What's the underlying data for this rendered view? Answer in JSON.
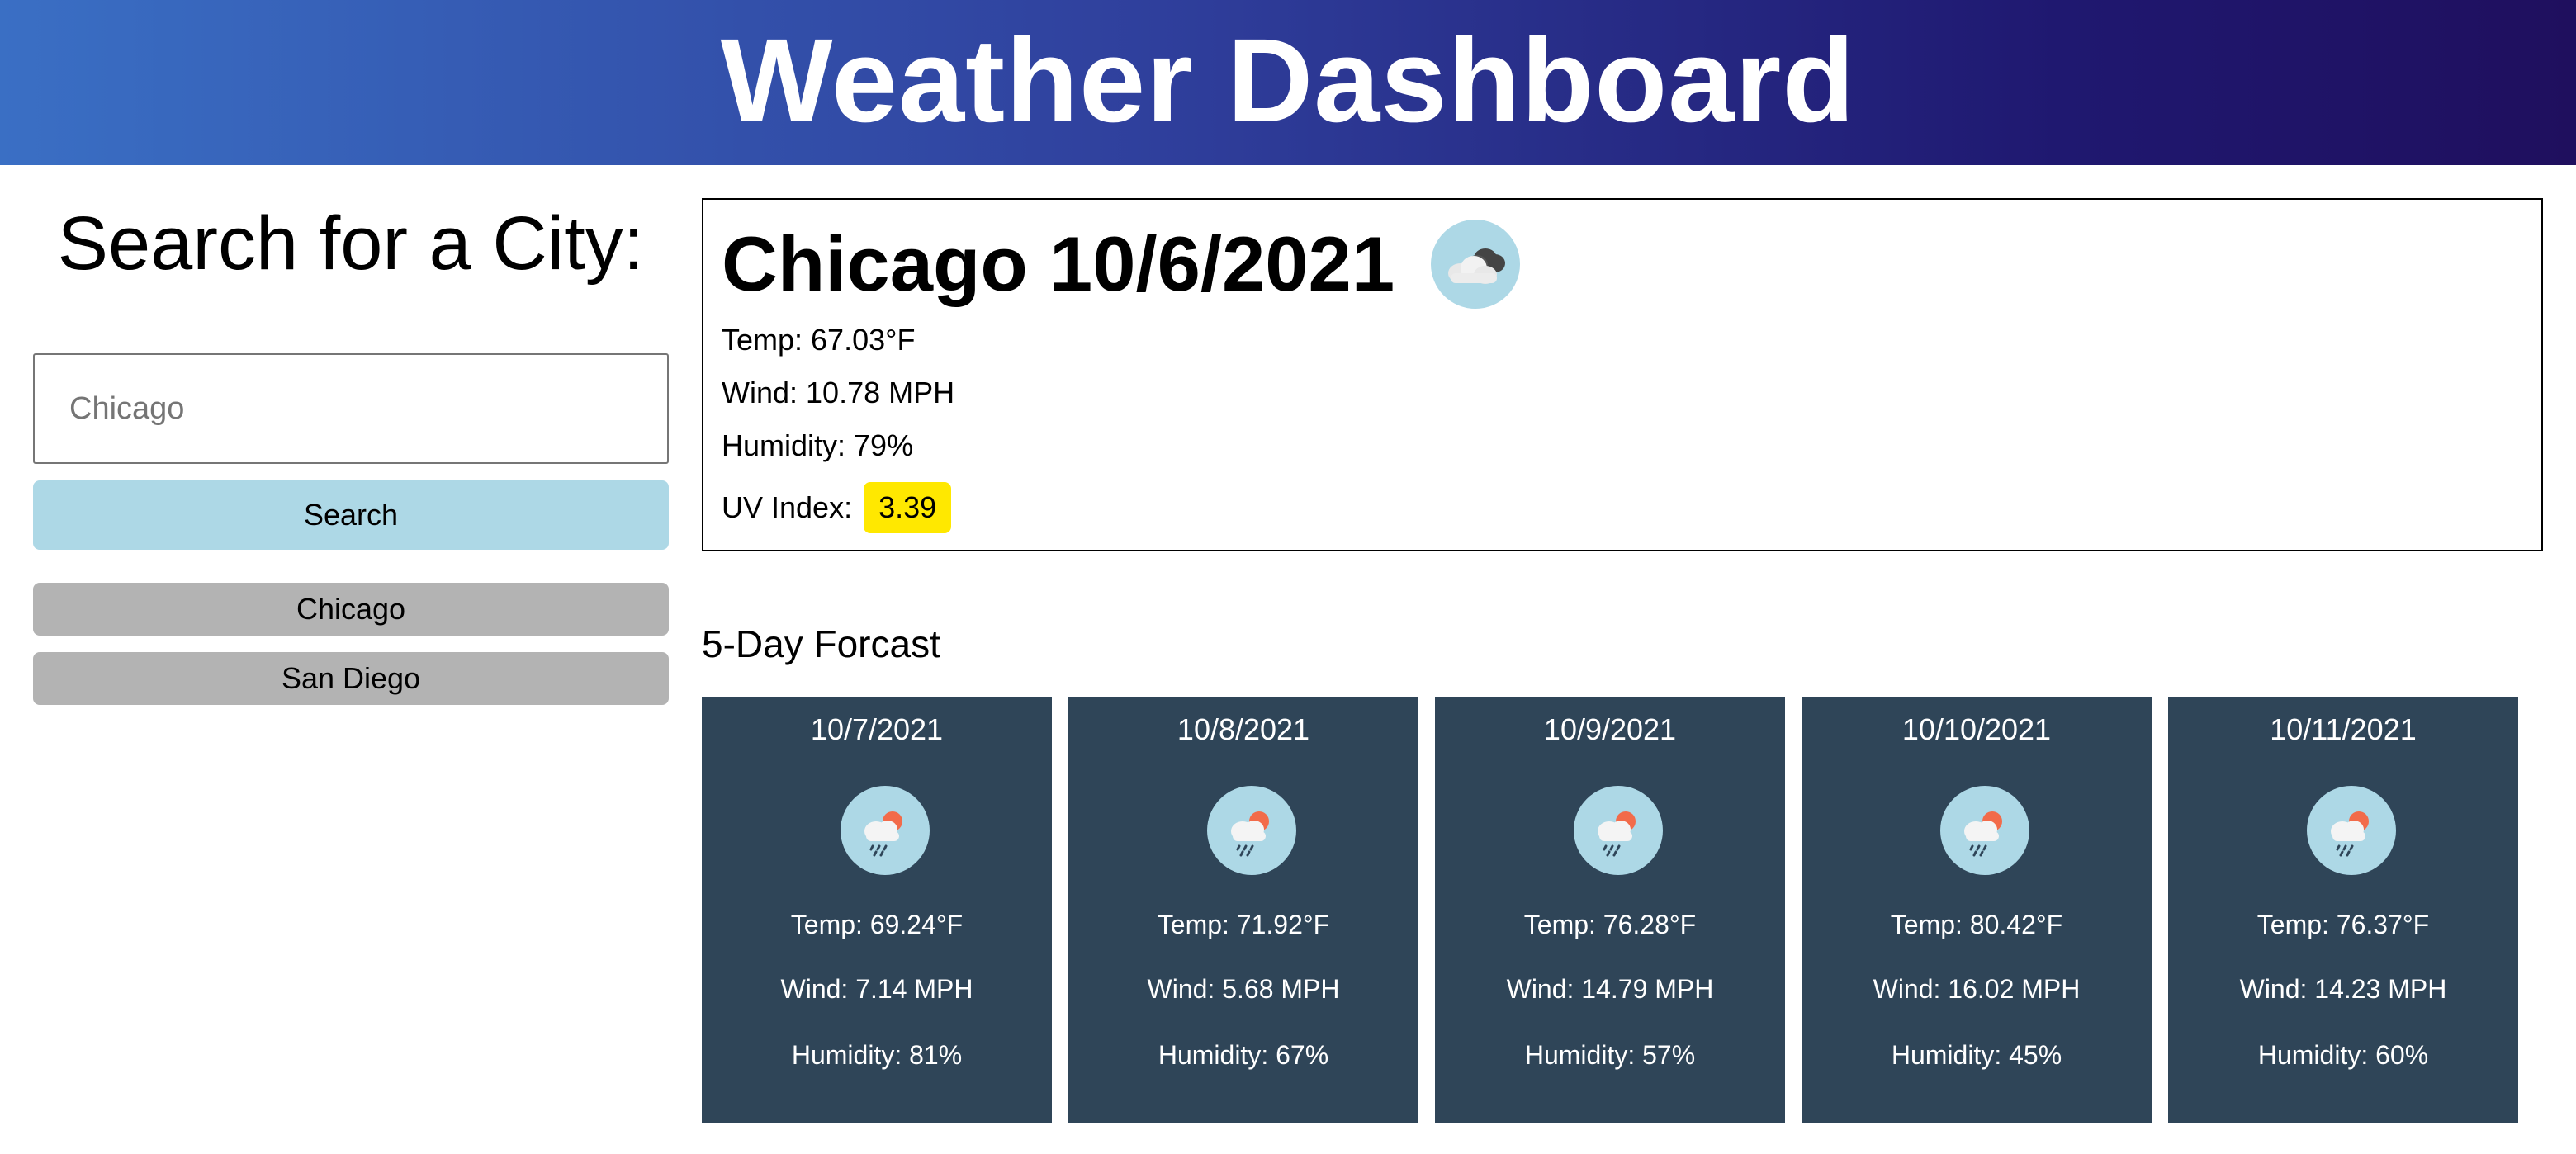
{
  "header": {
    "title": "Weather Dashboard"
  },
  "search": {
    "title": "Search for a City:",
    "input_placeholder": "Chicago",
    "button_label": "Search",
    "history": [
      "Chicago",
      "San Diego"
    ]
  },
  "current": {
    "title": "Chicago 10/6/2021",
    "icon": "cloudy-icon",
    "temp": "Temp: 67.03°F",
    "wind": "Wind: 10.78 MPH",
    "humidity": "Humidity: 79%",
    "uv_label": "UV Index:",
    "uv_value": "3.39",
    "uv_color": "#ffe800"
  },
  "forecast": {
    "title": "5-Day Forcast",
    "days": [
      {
        "date": "10/7/2021",
        "icon": "rain-sun-icon",
        "temp": "Temp: 69.24°F",
        "wind": "Wind: 7.14 MPH",
        "humidity": "Humidity: 81%"
      },
      {
        "date": "10/8/2021",
        "icon": "rain-sun-icon",
        "temp": "Temp: 71.92°F",
        "wind": "Wind: 5.68 MPH",
        "humidity": "Humidity: 67%"
      },
      {
        "date": "10/9/2021",
        "icon": "rain-sun-icon",
        "temp": "Temp: 76.28°F",
        "wind": "Wind: 14.79 MPH",
        "humidity": "Humidity: 57%"
      },
      {
        "date": "10/10/2021",
        "icon": "rain-sun-icon",
        "temp": "Temp: 80.42°F",
        "wind": "Wind: 16.02 MPH",
        "humidity": "Humidity: 45%"
      },
      {
        "date": "10/11/2021",
        "icon": "rain-sun-icon",
        "temp": "Temp: 76.37°F",
        "wind": "Wind: 14.23 MPH",
        "humidity": "Humidity: 60%"
      }
    ]
  },
  "colors": {
    "header_start": "#3a6fc4",
    "header_end": "#1f0f5e",
    "search_button": "#add8e6",
    "history_button": "#b3b3b3",
    "card_background": "#2f4558"
  }
}
